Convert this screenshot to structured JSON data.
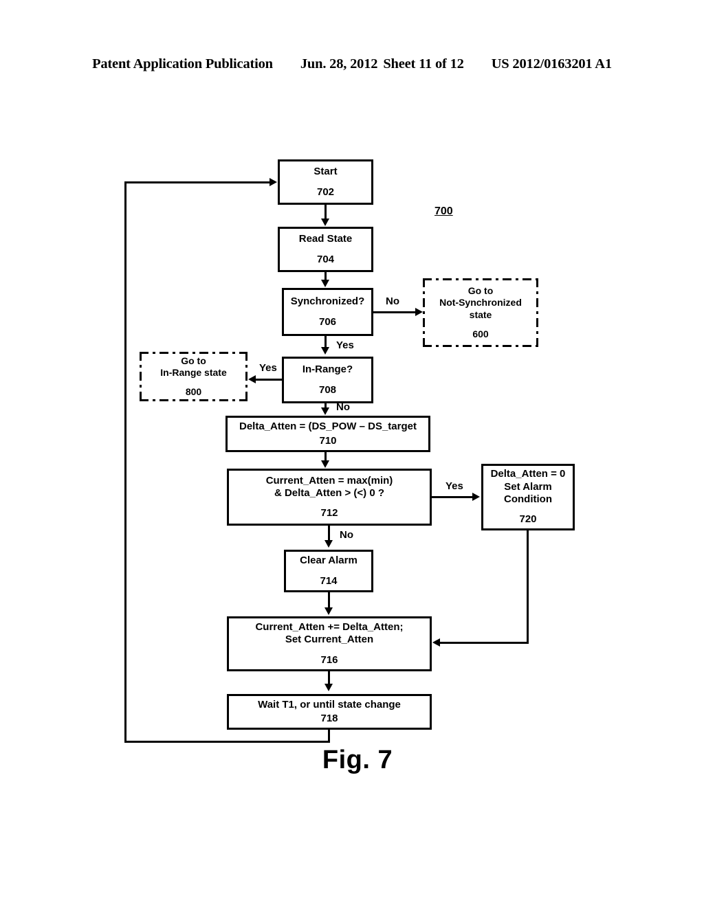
{
  "header": {
    "publication": "Patent Application Publication",
    "date": "Jun. 28, 2012",
    "sheet": "Sheet 11 of 12",
    "patent_number": "US 2012/0163201 A1"
  },
  "figure": {
    "caption": "Fig. 7",
    "diagram_ref": "700"
  },
  "nodes": {
    "start": {
      "text": "Start",
      "ref": "702"
    },
    "read_state": {
      "text": "Read State",
      "ref": "704"
    },
    "synchronized": {
      "text": "Synchronized?",
      "ref": "706"
    },
    "not_sync_state": {
      "text": "Go to\nNot-Synchronized\nstate",
      "ref": "600"
    },
    "in_range": {
      "text": "In-Range?",
      "ref": "708"
    },
    "in_range_state": {
      "text": "Go to\nIn-Range state",
      "ref": "800"
    },
    "delta_atten": {
      "text": "Delta_Atten = (DS_POW – DS_target",
      "ref": "710"
    },
    "current_atten_check": {
      "text": "Current_Atten = max(min)\n& Delta_Atten > (<) 0 ?",
      "ref": "712"
    },
    "clear_alarm": {
      "text": "Clear Alarm",
      "ref": "714"
    },
    "set_alarm": {
      "text": "Delta_Atten = 0\nSet Alarm\nCondition",
      "ref": "720"
    },
    "update_atten": {
      "text": "Current_Atten += Delta_Atten;\nSet Current_Atten",
      "ref": "716"
    },
    "wait": {
      "text": "Wait T1, or until state change",
      "ref": "718"
    }
  },
  "edge_labels": {
    "sync_no": "No",
    "sync_yes": "Yes",
    "inrange_yes": "Yes",
    "inrange_no": "No",
    "check_yes": "Yes",
    "check_no": "No"
  }
}
